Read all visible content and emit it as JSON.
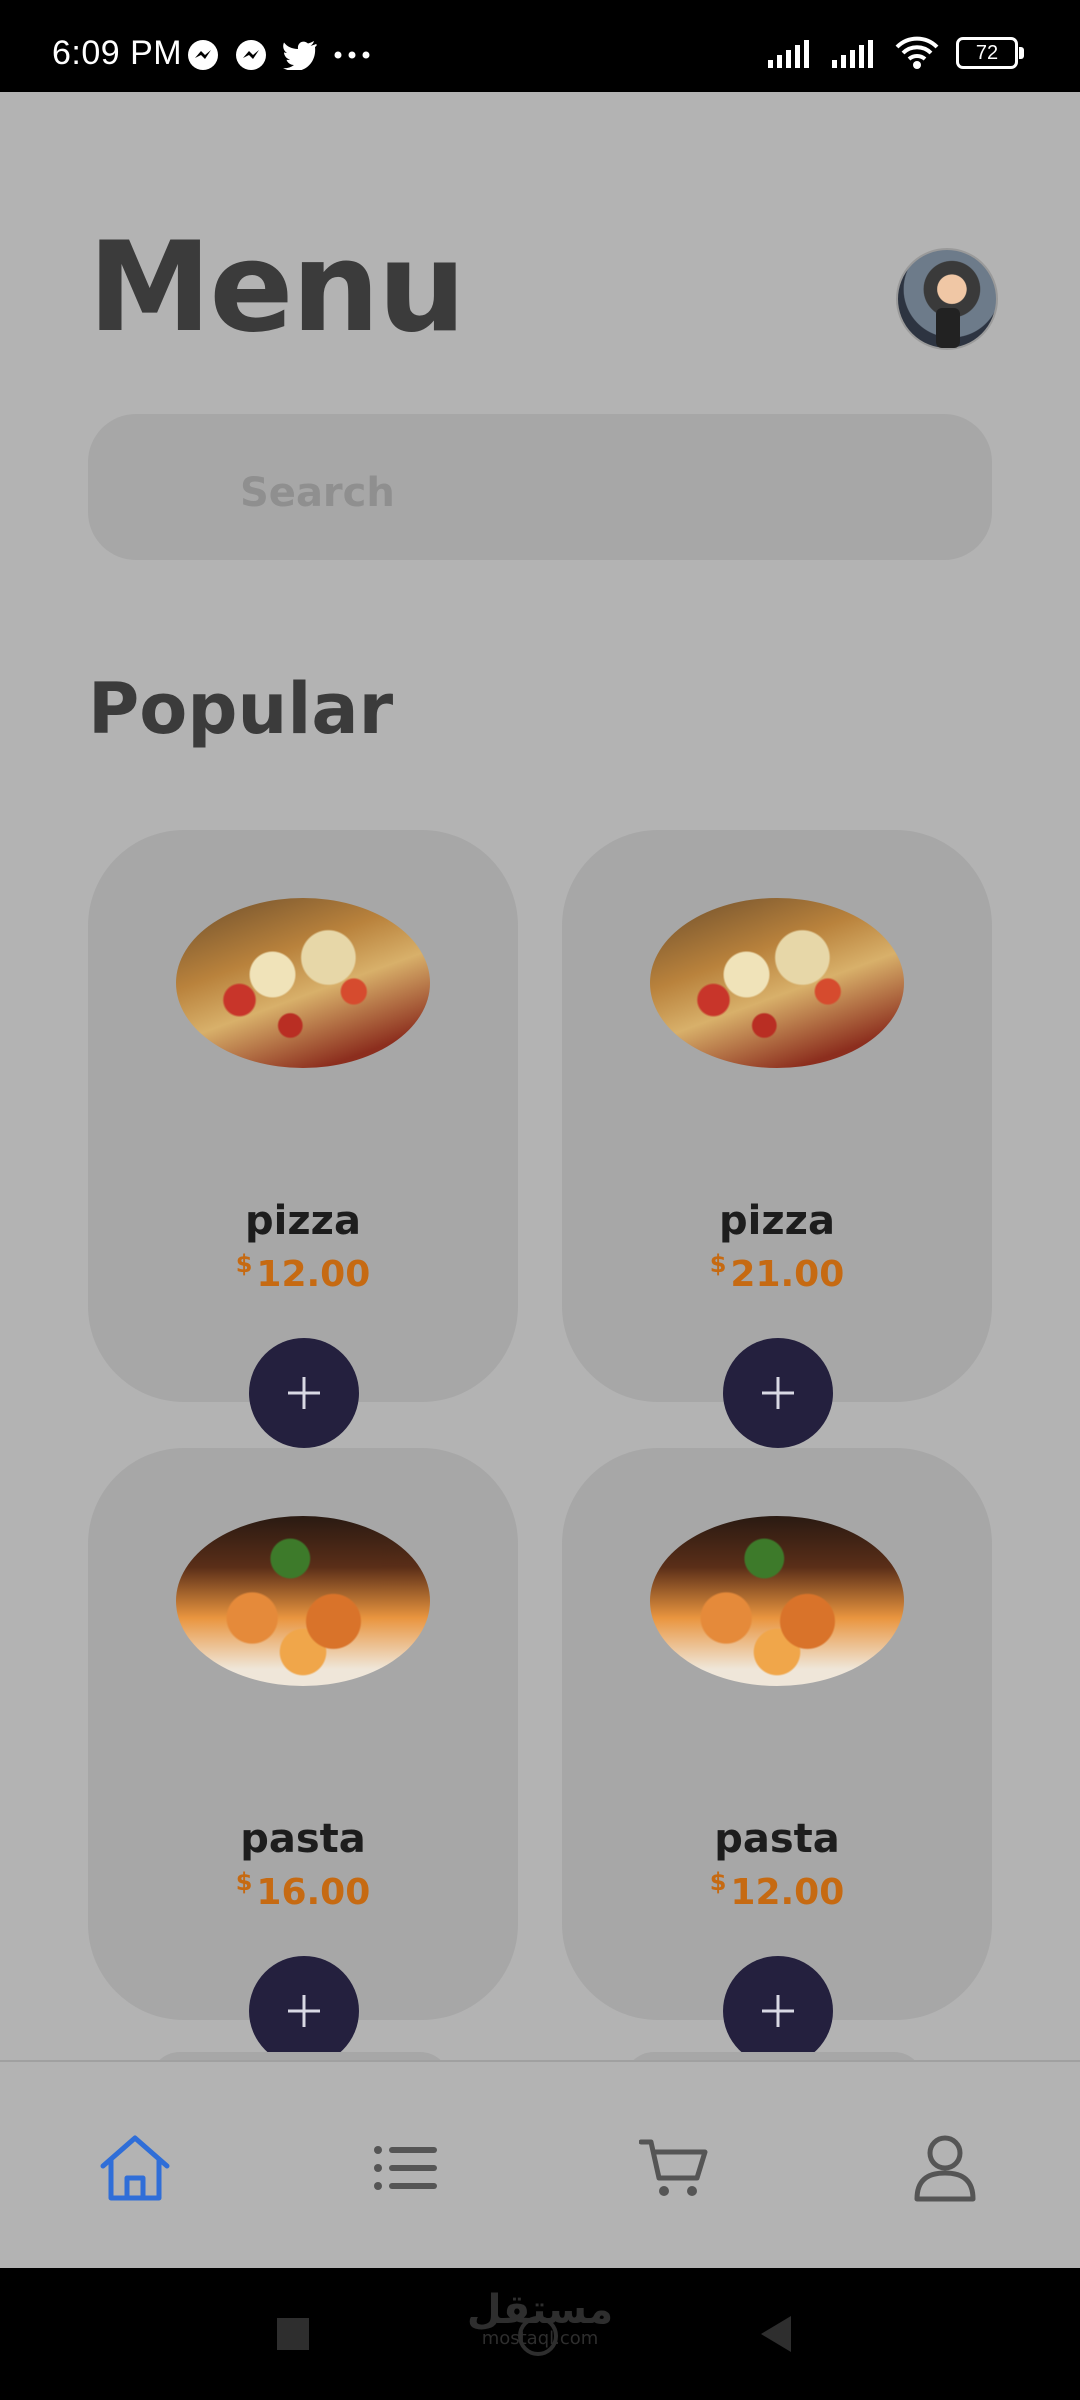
{
  "status_bar": {
    "time": "6:09 PM",
    "battery": "72",
    "icons": [
      "messenger-icon",
      "messenger-icon",
      "twitter-icon",
      "more-icon",
      "signal-icon",
      "signal-icon",
      "wifi-icon",
      "battery-icon"
    ]
  },
  "header": {
    "title": "Menu"
  },
  "search": {
    "placeholder": "Search"
  },
  "sections": {
    "popular_title": "Popular"
  },
  "products": [
    {
      "name": "pizza",
      "currency": "$",
      "price": "12.00",
      "image": "pizza"
    },
    {
      "name": "pizza",
      "currency": "$",
      "price": "21.00",
      "image": "pizza"
    },
    {
      "name": "pasta",
      "currency": "$",
      "price": "16.00",
      "image": "pasta"
    },
    {
      "name": "pasta",
      "currency": "$",
      "price": "12.00",
      "image": "pasta"
    }
  ],
  "bottom_nav": {
    "items": [
      "home-icon",
      "list-icon",
      "cart-icon",
      "profile-icon"
    ],
    "active_color": "#2f6ed8",
    "inactive_color": "#555555"
  },
  "system_nav": {
    "watermark_ar": "مستقل",
    "watermark_latin": "mostaql.com"
  },
  "colors": {
    "price": "#c66a12",
    "add_button": "#24203e",
    "background": "#b3b3b3"
  }
}
